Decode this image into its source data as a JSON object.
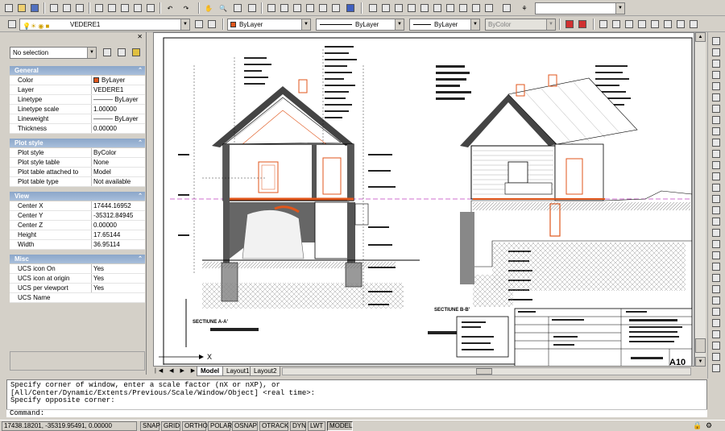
{
  "toolbar": {
    "layer_name": "VEDERE1",
    "color": "ByLayer",
    "linetype": "ByLayer",
    "lineweight": "ByLayer",
    "plotstyle": "ByColor"
  },
  "palette": {
    "selection": "No selection",
    "sections": [
      {
        "title": "General",
        "rows": [
          {
            "key": "Color",
            "value": "ByLayer"
          },
          {
            "key": "Layer",
            "value": "VEDERE1"
          },
          {
            "key": "Linetype",
            "value": "——— ByLayer"
          },
          {
            "key": "Linetype scale",
            "value": "1.00000"
          },
          {
            "key": "Lineweight",
            "value": "——— ByLayer"
          },
          {
            "key": "Thickness",
            "value": "0.00000"
          }
        ]
      },
      {
        "title": "Plot style",
        "rows": [
          {
            "key": "Plot style",
            "value": "ByColor"
          },
          {
            "key": "Plot style table",
            "value": "None"
          },
          {
            "key": "Plot table attached to",
            "value": "Model"
          },
          {
            "key": "Plot table type",
            "value": "Not available"
          }
        ]
      },
      {
        "title": "View",
        "rows": [
          {
            "key": "Center X",
            "value": "17444.16952"
          },
          {
            "key": "Center Y",
            "value": "-35312.84945"
          },
          {
            "key": "Center Z",
            "value": "0.00000"
          },
          {
            "key": "Height",
            "value": "17.65144"
          },
          {
            "key": "Width",
            "value": "36.95114"
          }
        ]
      },
      {
        "title": "Misc",
        "rows": [
          {
            "key": "UCS icon On",
            "value": "Yes"
          },
          {
            "key": "UCS icon at origin",
            "value": "Yes"
          },
          {
            "key": "UCS per viewport",
            "value": "Yes"
          },
          {
            "key": "UCS Name",
            "value": ""
          }
        ]
      }
    ]
  },
  "drawing": {
    "section_a": "SECTIUNE A-A'",
    "section_b": "SECTIUNE B-B'",
    "sheet_no": "A10",
    "axis_x": "X"
  },
  "tabs": [
    "Model",
    "Layout1",
    "Layout2"
  ],
  "command": {
    "history": [
      "Specify corner of window, enter a scale factor (nX or nXP), or",
      "[All/Center/Dynamic/Extents/Previous/Scale/Window/Object] <real time>:",
      "Specify opposite corner:"
    ],
    "prompt": "Command:"
  },
  "status": {
    "coords": "17438.18201, -35319.95491, 0.00000",
    "buttons": [
      "SNAP",
      "GRID",
      "ORTHO",
      "POLAR",
      "OSNAP",
      "OTRACK",
      "DYN",
      "LWT",
      "MODEL"
    ]
  },
  "colors": {
    "accent_orange": "#e0561b",
    "title_bar": "#8ba6c9"
  }
}
